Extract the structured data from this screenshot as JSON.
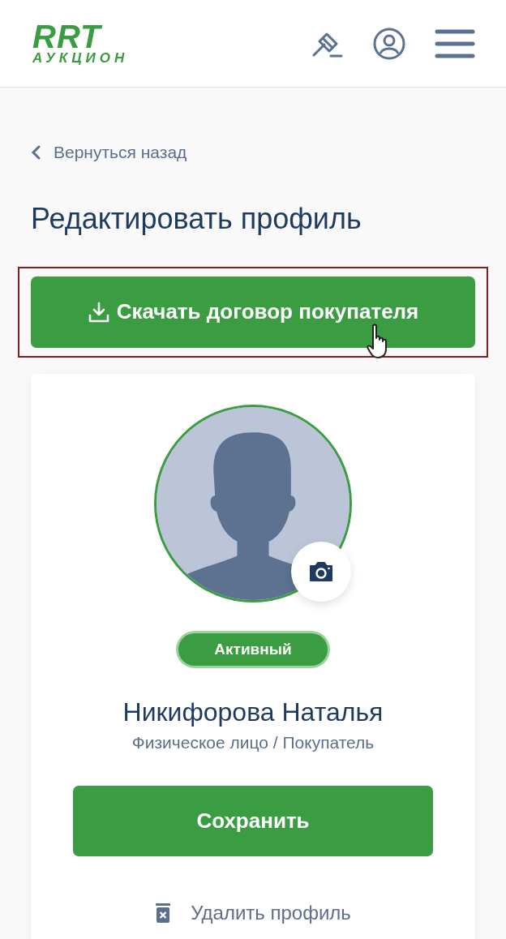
{
  "header": {
    "logo_title": "RRT",
    "logo_subtitle": "АУКЦИОН"
  },
  "back_link": {
    "label": "Вернуться назад"
  },
  "page_title": "Редактировать профиль",
  "download_button": {
    "label": "Скачать договор покупателя",
    "highlighted": true
  },
  "profile": {
    "status": {
      "label": "Активный",
      "active": true
    },
    "name": "Никифорова Наталья",
    "role": "Физическое лицо / Покупатель",
    "save_button": "Сохранить",
    "delete_link": "Удалить профиль"
  }
}
